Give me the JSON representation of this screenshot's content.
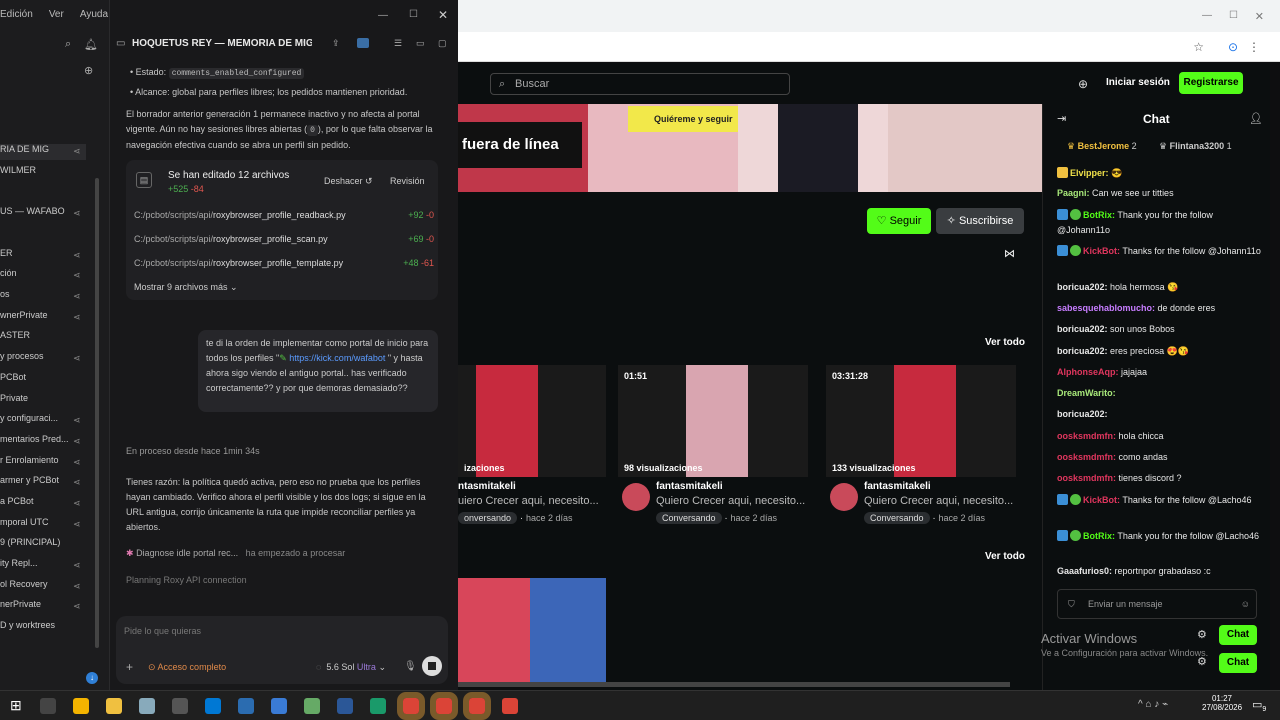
{
  "sidebar": {
    "menu": [
      "Edición",
      "Ver",
      "Ayuda"
    ],
    "items": [
      "RIA DE MIG",
      "WILMER",
      "US — WAFABO",
      "ER",
      "ción",
      "os",
      "wnerPrivate",
      "ASTER",
      "y procesos",
      "PCBot",
      "Private",
      "y configuraci...",
      "mentarios Pred...",
      "r Enrolamiento",
      "armer y PCBot",
      "a PCBot",
      "mporal UTC",
      "9 (PRINCIPAL)",
      "ity Repl...",
      "ol Recovery",
      "nerPrivate",
      "D y worktrees"
    ]
  },
  "editor": {
    "title": "HOQUETUS REY — MEMORIA DE MIGI",
    "status_prefix": "Estado:",
    "status_code": "comments_enabled_configured",
    "alcance": "Alcance: global para perfiles libres; los pedidos mantienen prioridad.",
    "para1_a": "El borrador anterior generación 1 permanece inactivo y no afecta al portal vigente. Aún no hay sesiones libres abiertas (",
    "para1_code": "0",
    "para1_b": "), por lo que falta observar la navegación efectiva cuando se abra un perfil sin pedido.",
    "card_title": "Se han editado 12 archivos",
    "card_plus": "+525",
    "card_minus": "-84",
    "undo": "Deshacer",
    "review": "Revisión",
    "files": [
      {
        "prefix": "C:/pcbot/scripts/api/",
        "name": "roxybrowser_profile_readback.py",
        "plus": "+92",
        "minus": "-0"
      },
      {
        "prefix": "C:/pcbot/scripts/api/",
        "name": "roxybrowser_profile_scan.py",
        "plus": "+69",
        "minus": "-0"
      },
      {
        "prefix": "C:/pcbot/scripts/api/",
        "name": "roxybrowser_profile_template.py",
        "plus": "+48",
        "minus": "-61"
      }
    ],
    "more": "Mostrar 9 archivos más",
    "user_msg_a": "te di la orden de implementar como portal de inicio para todos los perfiles \"",
    "user_msg_link": "https://kick.com/wafabot",
    "user_msg_b": "\" y hasta ahora sigo viendo el antiguo portal.. has verificado correctamente?? y por que demoras demasiado??",
    "progress": "En proceso desde hace 1min 34s",
    "reply": "Tienes razón: la política quedó activa, pero eso no prueba que los perfiles hayan cambiado. Verifico ahora el perfil visible y los dos logs; si sigue en la URL antigua, corrijo únicamente la ruta que impide reconciliar perfiles ya abiertos.",
    "task": "Diagnose idle portal rec...",
    "task_status": "ha empezado a procesar",
    "planning": "Planning Roxy API connection",
    "placeholder": "Pide lo que quieras",
    "access": "Acceso completo",
    "model": "5.6 Sol",
    "model_tier": "Ultra"
  },
  "kick": {
    "search": "Buscar",
    "login": "Iniciar sesión",
    "register": "Registrarse",
    "banner_sign": "Quiéreme y seguir",
    "offline": "fuera de línea",
    "follow": "Seguir",
    "subscribe": "Suscribirse",
    "see_all": "Ver todo",
    "videos": [
      {
        "duration": "",
        "views": "izaciones",
        "channel": "ntasmitakeli",
        "title": "uiero Crecer aqui, necesito...",
        "tag": "onversando",
        "ago": "hace 2 días"
      },
      {
        "duration": "01:51",
        "views": "98 visualizaciones",
        "channel": "fantasmitakeli",
        "title": "Quiero Crecer aqui, necesito...",
        "tag": "Conversando",
        "ago": "hace 2 días"
      },
      {
        "duration": "03:31:28",
        "views": "133 visualizaciones",
        "channel": "fantasmitakeli",
        "title": "Quiero Crecer aqui, necesito...",
        "tag": "Conversando",
        "ago": "hace 2 días"
      }
    ]
  },
  "kchat": {
    "title": "Chat",
    "top": [
      {
        "name": "BestJerome",
        "n": "2"
      },
      {
        "name": "Flintana3200",
        "n": "1"
      }
    ],
    "messages": [
      {
        "user": "Elvipper:",
        "text": "😎",
        "color": "#f0e14a"
      },
      {
        "user": "Paagni:",
        "text": "Can we see ur titties",
        "color": "#a8e87a"
      },
      {
        "user": "BotRix:",
        "text": "Thank you for the follow @Johann11o",
        "color": "#53fc18"
      },
      {
        "user": "KickBot:",
        "text": "Thanks for the follow @Johann11o",
        "color": "#e0365e"
      },
      {
        "user": "boricua202:",
        "text": "hola hermosa 😘",
        "color": "#e8e8e8"
      },
      {
        "user": "sabesquehablomucho:",
        "text": "de donde eres",
        "color": "#c77dff"
      },
      {
        "user": "boricua202:",
        "text": "son unos Bobos",
        "color": "#e8e8e8"
      },
      {
        "user": "boricua202:",
        "text": "eres preciosa 😍😘",
        "color": "#e8e8e8"
      },
      {
        "user": "AlphonseAqp:",
        "text": "jajajaa",
        "color": "#e0365e"
      },
      {
        "user": "DreamWarito:",
        "text": "",
        "color": "#a8e87a"
      },
      {
        "user": "boricua202:",
        "text": "",
        "color": "#e8e8e8"
      },
      {
        "user": "oosksmdmfn:",
        "text": "hola chicca",
        "color": "#e0365e"
      },
      {
        "user": "oosksmdmfn:",
        "text": "como andas",
        "color": "#e0365e"
      },
      {
        "user": "oosksmdmfn:",
        "text": "tienes discord ?",
        "color": "#e0365e"
      },
      {
        "user": "KickBot:",
        "text": "Thanks for the follow @Lacho46",
        "color": "#e0365e"
      },
      {
        "user": "BotRix:",
        "text": "Thank you for the follow @Lacho46",
        "color": "#53fc18"
      },
      {
        "user": "Gaaafurios0:",
        "text": "reportnpor grabadaso :c",
        "color": "#e8e8e8"
      }
    ],
    "input": "Enviar un mensaje",
    "send": "Chat"
  },
  "windows": {
    "activate": "Activar Windows",
    "activate_sub": "Ve a Configuración para activar Windows.",
    "time": "01:27",
    "date": "27/08/2026",
    "notif": "9"
  }
}
